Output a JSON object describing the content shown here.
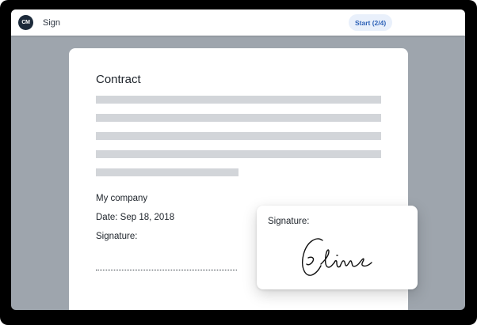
{
  "app": {
    "logo_text": "CM",
    "title": "Sign",
    "step_button": "Start (2/4)"
  },
  "document": {
    "title": "Contract",
    "placeholder_line_count": 5,
    "company": "My company",
    "date": "Date: Sep 18, 2018",
    "signature_label": "Signature:"
  },
  "signature_card": {
    "label": "Signature:",
    "signature_name": "Celine"
  },
  "colors": {
    "backdrop": "#9ea5ad",
    "placeholder_text": "#d2d5d9",
    "logo": "#1c2a3a",
    "accent": "#2f63b8",
    "pill_bg": "#e9f0fb"
  }
}
